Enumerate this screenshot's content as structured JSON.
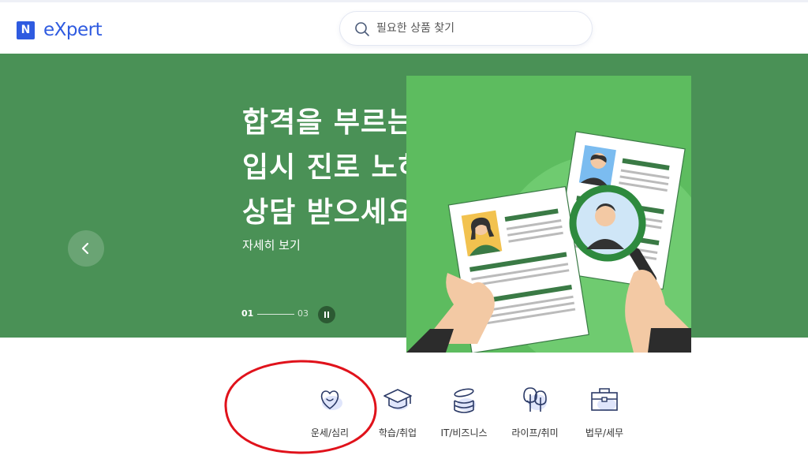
{
  "header": {
    "logo_letter": "N",
    "logo_text": "eXpert",
    "search": {
      "placeholder": "필요한 상품 찾기",
      "icon": "search-icon"
    }
  },
  "banner": {
    "headline": [
      "합격을 부르는",
      "입시 진로 노하우",
      "상담 받으세요!"
    ],
    "cta": "자세히 보기",
    "pager": {
      "current": "01",
      "total": "03",
      "progress": 0.33
    },
    "background_color": "#4a9156",
    "illustration_color": "#5dbc5f"
  },
  "categories": [
    {
      "label": "운세/심리",
      "icon": "heart-icon"
    },
    {
      "label": "학습/취업",
      "icon": "graduation-cap-icon"
    },
    {
      "label": "IT/비즈니스",
      "icon": "coins-icon"
    },
    {
      "label": "라이프/취미",
      "icon": "trees-icon"
    },
    {
      "label": "법무/세무",
      "icon": "briefcase-icon"
    }
  ],
  "colors": {
    "brand": "#2f5be0",
    "annotation": "#e0121b"
  }
}
